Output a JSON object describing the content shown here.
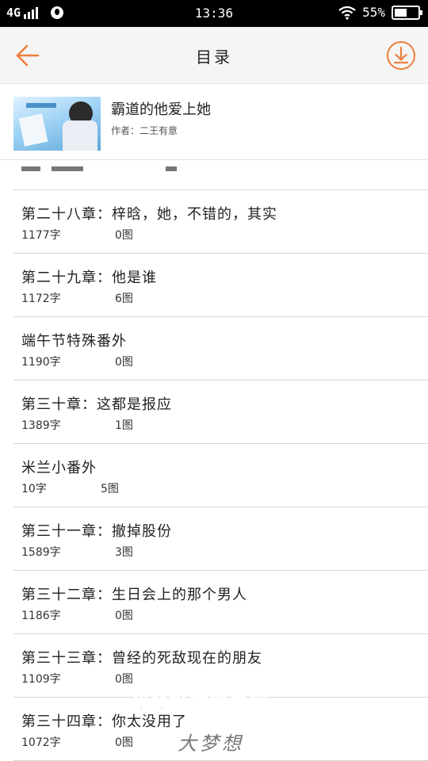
{
  "status_bar": {
    "network": "4G",
    "time": "13:36",
    "battery": "55%",
    "battery_level": 0.55
  },
  "nav": {
    "title": "目录",
    "back_icon": "back-arrow-icon",
    "download_icon": "download-icon",
    "accent_color": "#ef7e3a"
  },
  "book": {
    "title": "霸道的他爱上她",
    "author": "作者：二王有意"
  },
  "chapters": [
    {
      "title": "第二十八章：梓晗，她，不错的，其实",
      "words": "1177字",
      "pictures": "0图"
    },
    {
      "title": "第二十九章：他是谁",
      "words": "1172字",
      "pictures": "6图"
    },
    {
      "title": "端午节特殊番外",
      "words": "1190字",
      "pictures": "0图"
    },
    {
      "title": "第三十章：这都是报应",
      "words": "1389字",
      "pictures": "1图"
    },
    {
      "title": "米兰小番外",
      "words": "10字",
      "pictures": "5图"
    },
    {
      "title": "第三十一章：撤掉股份",
      "words": "1589字",
      "pictures": "3图"
    },
    {
      "title": "第三十二章：生日会上的那个男人",
      "words": "1186字",
      "pictures": "0图"
    },
    {
      "title": "第三十三章：曾经的死敌现在的朋友",
      "words": "1109字",
      "pictures": "0图"
    },
    {
      "title": "第三十四章：你太没用了",
      "words": "1072字",
      "pictures": "0图"
    }
  ],
  "overlay": {
    "slogan": "我会挺你到最后",
    "name": "大梦想"
  }
}
